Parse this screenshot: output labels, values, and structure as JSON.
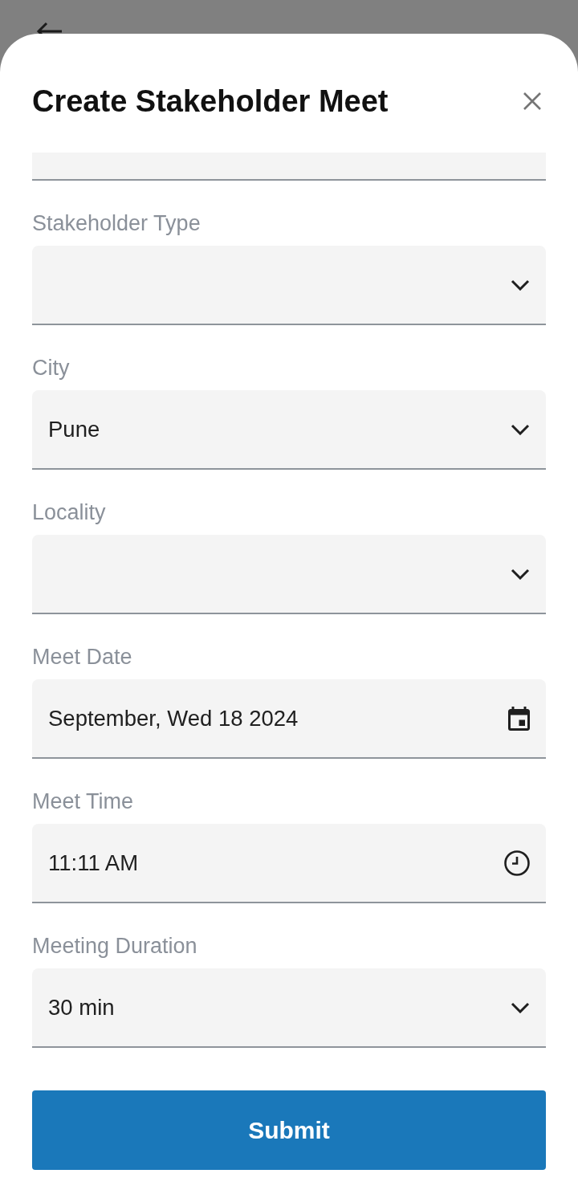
{
  "sheet": {
    "title": "Create Stakeholder Meet"
  },
  "fields": [
    {
      "label": "Stakeholder Type",
      "kind": "dropdown"
    },
    {
      "label": "City",
      "kind": "dropdown",
      "value": "Pune"
    },
    {
      "label": "Locality",
      "kind": "dropdown"
    },
    {
      "label": "Meet Date",
      "kind": "date",
      "value": "September, Wed 18 2024"
    },
    {
      "label": "Meet Time",
      "kind": "time",
      "value": "11:11 AM"
    },
    {
      "label": "Meeting Duration",
      "kind": "dropdown",
      "value": "30 min"
    }
  ],
  "submit_button": {
    "label": "Submit"
  }
}
